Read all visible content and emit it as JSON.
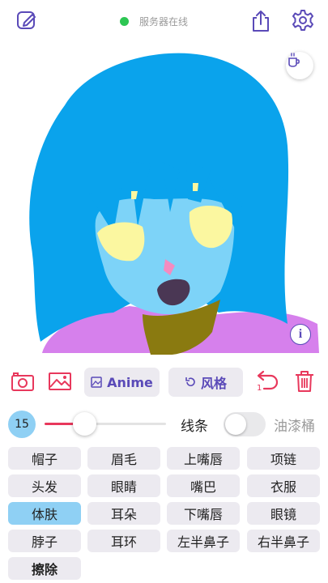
{
  "app": {
    "status_text": "服务器在线",
    "status_color": "#2dc653",
    "accent_color": "#5a4ab8",
    "danger_color": "#e8385c",
    "icons": {
      "edit": "edit-icon",
      "share": "share-icon",
      "settings": "gear-icon",
      "coffee": "coffee-icon",
      "info": "info-icon"
    }
  },
  "toolbar": {
    "camera_icon": "camera-icon",
    "gallery_icon": "image-icon",
    "anime_label": "Anime",
    "style_label": "风格",
    "undo_count": "1",
    "undo_icon": "undo-icon",
    "delete_icon": "trash-icon"
  },
  "brush": {
    "size": "15",
    "slider_fraction": 0.33,
    "mode_left": "线条",
    "mode_right": "油漆桶",
    "paint_bucket_on": false
  },
  "parts": [
    {
      "label": "帽子",
      "active": false
    },
    {
      "label": "眉毛",
      "active": false
    },
    {
      "label": "上嘴唇",
      "active": false
    },
    {
      "label": "项链",
      "active": false
    },
    {
      "label": "头发",
      "active": false
    },
    {
      "label": "眼睛",
      "active": false
    },
    {
      "label": "嘴巴",
      "active": false
    },
    {
      "label": "衣服",
      "active": false
    },
    {
      "label": "体肤",
      "active": true
    },
    {
      "label": "耳朵",
      "active": false
    },
    {
      "label": "下嘴唇",
      "active": false
    },
    {
      "label": "眼镜",
      "active": false
    },
    {
      "label": "脖子",
      "active": false
    },
    {
      "label": "耳环",
      "active": false
    },
    {
      "label": "左半鼻子",
      "active": false
    },
    {
      "label": "右半鼻子",
      "active": false
    }
  ],
  "erase_label": "擦除",
  "drawing_colors": {
    "hair": "#0aa3ec",
    "skin": "#7dd3f8",
    "eyes": "#fbf7a0",
    "mouth": "#4a3754",
    "nose": "#f48bc0",
    "neck": "#8a7a10",
    "clothes": "#d680ec"
  }
}
